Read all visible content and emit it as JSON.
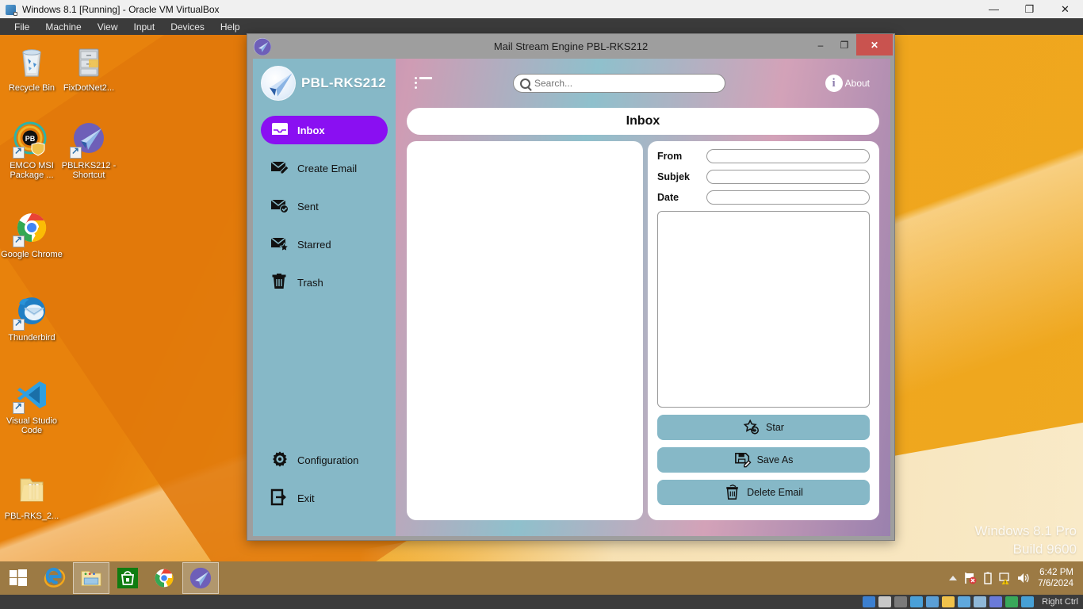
{
  "vbox": {
    "title": "Windows 8.1 [Running] - Oracle VM VirtualBox",
    "icon": "virtualbox-icon",
    "menu": [
      "File",
      "Machine",
      "View",
      "Input",
      "Devices",
      "Help"
    ],
    "window_controls": {
      "minimize": "—",
      "restore": "❐",
      "close": "✕"
    },
    "status_right_label": "Right Ctrl"
  },
  "desktop": {
    "icons": [
      {
        "name": "recycle-bin",
        "label": "Recycle Bin",
        "shortcut": false
      },
      {
        "name": "fixdotnet",
        "label": "FixDotNet2...",
        "shortcut": false
      },
      {
        "name": "emco-msi-package",
        "label": "EMCO MSI Package ...",
        "shortcut": true
      },
      {
        "name": "pblrks212-shortcut",
        "label": "PBLRKS212 - Shortcut",
        "shortcut": true
      },
      {
        "name": "google-chrome",
        "label": "Google Chrome",
        "shortcut": true
      },
      {
        "name": "thunderbird",
        "label": "Thunderbird",
        "shortcut": true
      },
      {
        "name": "visual-studio-code",
        "label": "Visual Studio Code",
        "shortcut": true
      },
      {
        "name": "pbl-rks-folder",
        "label": "PBL-RKS_2...",
        "shortcut": false
      }
    ],
    "watermark_line1": "Windows 8.1 Pro",
    "watermark_line2": "Build 9600"
  },
  "taskbar": {
    "items": [
      {
        "name": "start-button",
        "icon": "windows-logo-icon",
        "active": false
      },
      {
        "name": "internet-explorer",
        "icon": "ie-icon",
        "active": false
      },
      {
        "name": "file-explorer",
        "icon": "folder-icon",
        "active": true
      },
      {
        "name": "windows-store",
        "icon": "store-bag-icon",
        "active": false
      },
      {
        "name": "chrome",
        "icon": "chrome-icon",
        "active": false
      },
      {
        "name": "mail-stream-engine",
        "icon": "paper-plane-icon",
        "active": true
      }
    ],
    "tray": [
      "show-hidden-icons",
      "flag-icon",
      "battery-icon",
      "network-warning-icon",
      "volume-icon"
    ],
    "clock_time": "6:42 PM",
    "clock_date": "7/6/2024"
  },
  "app": {
    "title": "Mail Stream Engine PBL-RKS212",
    "window_controls": {
      "minimize": "–",
      "restore": "❐",
      "close": "✕"
    },
    "brand": "PBL-RKS212",
    "search": {
      "value": "",
      "placeholder": "Search..."
    },
    "about_label": "About",
    "page_title": "Inbox",
    "nav_top": [
      {
        "label": "Inbox",
        "icon": "inbox-icon",
        "active": true
      },
      {
        "label": "Create Email",
        "icon": "compose-email-icon",
        "active": false
      },
      {
        "label": "Sent",
        "icon": "sent-email-icon",
        "active": false
      },
      {
        "label": "Starred",
        "icon": "starred-email-icon",
        "active": false
      },
      {
        "label": "Trash",
        "icon": "trash-icon",
        "active": false
      }
    ],
    "nav_bottom": [
      {
        "label": "Configuration",
        "icon": "gear-icon",
        "active": false
      },
      {
        "label": "Exit",
        "icon": "exit-icon",
        "active": false
      }
    ],
    "detail_fields": [
      {
        "label": "From",
        "value": ""
      },
      {
        "label": "Subjek",
        "value": ""
      },
      {
        "label": "Date",
        "value": ""
      }
    ],
    "body_value": "",
    "actions": [
      {
        "label": "Star",
        "icon": "star-add-icon"
      },
      {
        "label": "Save As",
        "icon": "save-as-icon"
      },
      {
        "label": "Delete Email",
        "icon": "trash-icon"
      }
    ]
  },
  "colors": {
    "sidebar": "#86b8c7",
    "active_nav": "#8a0ff2",
    "close_button": "#c9534f",
    "titlebar": "#9e9e9e",
    "taskbar": "#9c7a44"
  }
}
